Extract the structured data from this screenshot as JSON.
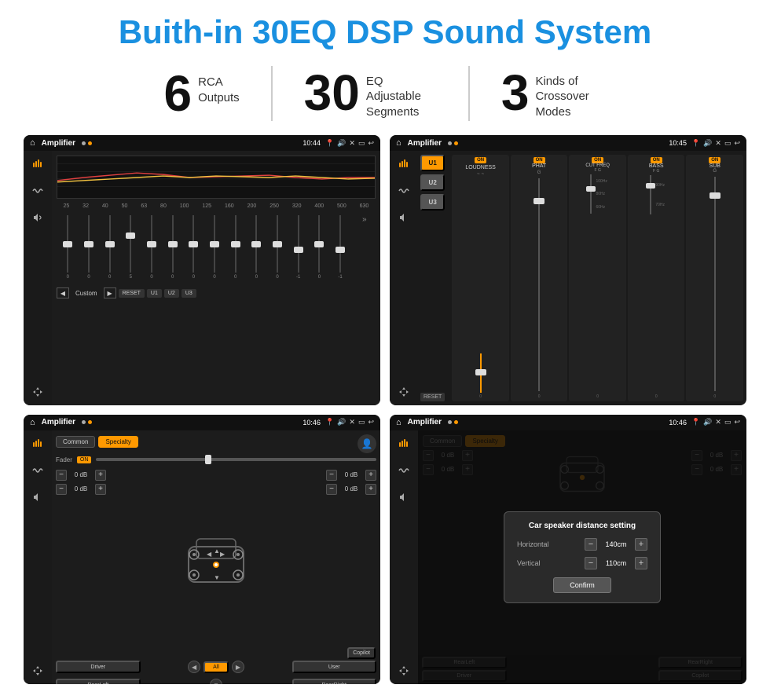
{
  "title": "Buith-in 30EQ DSP Sound System",
  "stats": [
    {
      "number": "6",
      "label": "RCA\nOutputs"
    },
    {
      "number": "30",
      "label": "EQ Adjustable\nSegments"
    },
    {
      "number": "3",
      "label": "Kinds of\nCrossover Modes"
    }
  ],
  "screens": [
    {
      "id": "eq-screen",
      "statusBar": {
        "title": "Amplifier",
        "time": "10:44"
      },
      "type": "eq",
      "freqs": [
        "25",
        "32",
        "40",
        "50",
        "63",
        "80",
        "100",
        "125",
        "160",
        "200",
        "250",
        "320",
        "400",
        "500",
        "630"
      ],
      "sliderValues": [
        "0",
        "0",
        "0",
        "5",
        "0",
        "0",
        "0",
        "0",
        "0",
        "0",
        "0",
        "-1",
        "0",
        "-1"
      ],
      "controls": [
        "◀",
        "Custom",
        "▶",
        "RESET",
        "U1",
        "U2",
        "U3"
      ]
    },
    {
      "id": "crossover-screen",
      "statusBar": {
        "title": "Amplifier",
        "time": "10:45"
      },
      "type": "crossover",
      "presets": [
        "U1",
        "U2",
        "U3"
      ],
      "sections": [
        {
          "label": "LOUDNESS",
          "on": true
        },
        {
          "label": "PHAT",
          "on": true
        },
        {
          "label": "CUT FREQ",
          "on": true
        },
        {
          "label": "BASS",
          "on": true
        },
        {
          "label": "SUB",
          "on": true
        }
      ]
    },
    {
      "id": "fader-screen",
      "statusBar": {
        "title": "Amplifier",
        "time": "10:46"
      },
      "type": "fader",
      "tabs": [
        "Common",
        "Specialty"
      ],
      "activeTab": 1,
      "faderLabel": "Fader",
      "faderOn": true,
      "volumes": [
        {
          "value": "0 dB"
        },
        {
          "value": "0 dB"
        },
        {
          "value": "0 dB"
        },
        {
          "value": "0 dB"
        }
      ],
      "bottomBtns": [
        "Driver",
        "All",
        "User",
        "RearLeft",
        "Copilot",
        "RearRight"
      ]
    },
    {
      "id": "dialog-screen",
      "statusBar": {
        "title": "Amplifier",
        "time": "10:46"
      },
      "type": "dialog",
      "dialog": {
        "title": "Car speaker distance setting",
        "fields": [
          {
            "label": "Horizontal",
            "value": "140cm"
          },
          {
            "label": "Vertical",
            "value": "110cm"
          }
        ],
        "confirmLabel": "Confirm"
      },
      "volumes": [
        {
          "value": "0 dB"
        },
        {
          "value": "0 dB"
        }
      ],
      "bottomBtns": [
        "Driver",
        "RearLeft",
        "Copilot",
        "RearRight"
      ]
    }
  ]
}
